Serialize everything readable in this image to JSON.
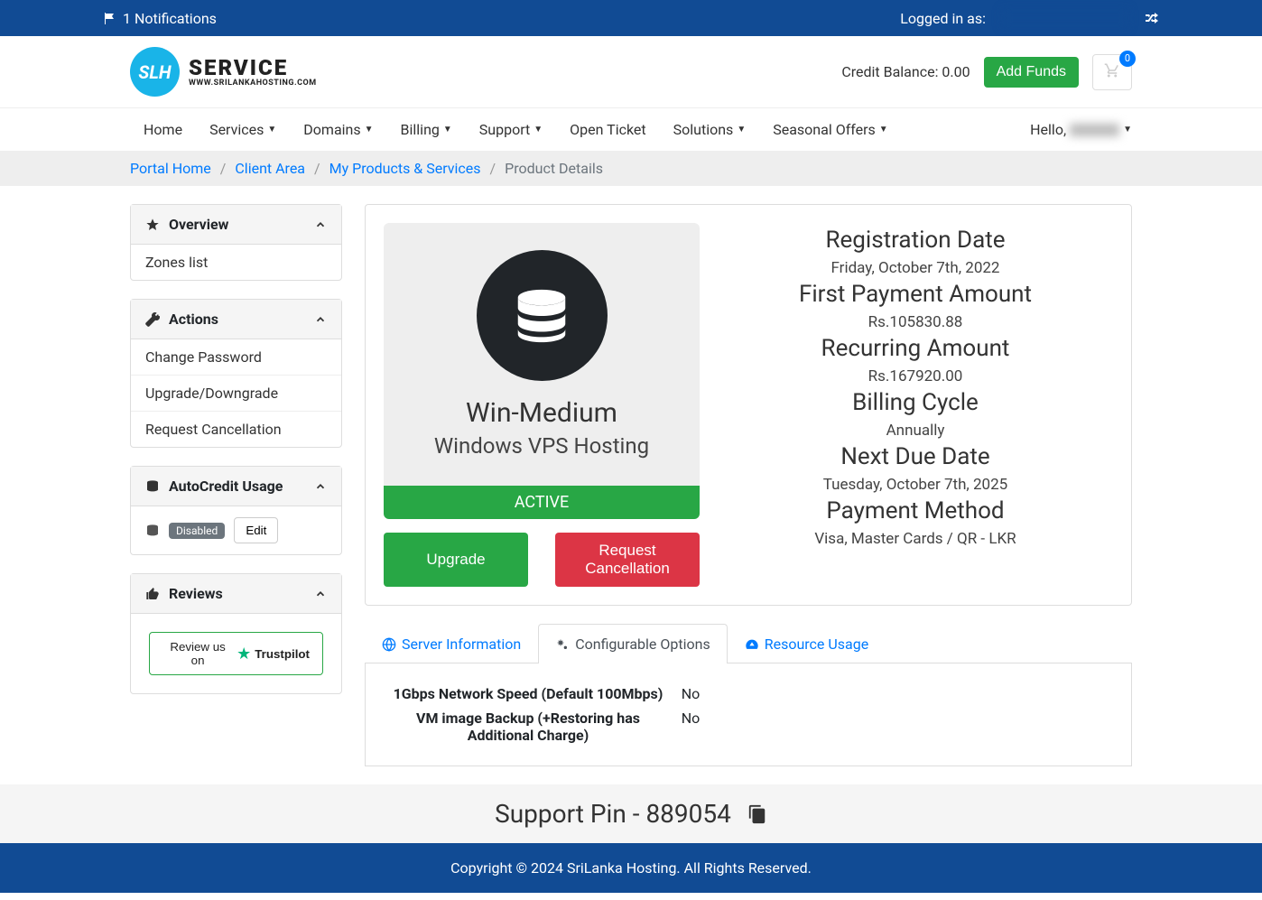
{
  "topbar": {
    "notifications": "1 Notifications",
    "logged_in_as": "Logged in as:"
  },
  "header": {
    "logo_text": "SERVICE",
    "logo_sub": "WWW.SRILANKAHOSTING.COM",
    "logo_badge": "SLH",
    "credit_balance": "Credit Balance: 0.00",
    "add_funds": "Add Funds",
    "cart_count": "0"
  },
  "nav": {
    "items": [
      "Home",
      "Services",
      "Domains",
      "Billing",
      "Support",
      "Open Ticket",
      "Solutions",
      "Seasonal Offers"
    ],
    "hello": "Hello,"
  },
  "breadcrumb": {
    "items": [
      "Portal Home",
      "Client Area",
      "My Products & Services"
    ],
    "current": "Product Details"
  },
  "sidebar": {
    "overview": {
      "title": "Overview",
      "items": [
        "Zones list"
      ]
    },
    "actions": {
      "title": "Actions",
      "items": [
        "Change Password",
        "Upgrade/Downgrade",
        "Request Cancellation"
      ]
    },
    "autocredit": {
      "title": "AutoCredit Usage",
      "badge": "Disabled",
      "edit": "Edit"
    },
    "reviews": {
      "title": "Reviews",
      "review_text": "Review us on",
      "trustpilot": "Trustpilot"
    }
  },
  "product": {
    "name": "Win-Medium",
    "category": "Windows VPS Hosting",
    "status": "ACTIVE",
    "upgrade": "Upgrade",
    "cancel": "Request Cancellation",
    "info": [
      {
        "label": "Registration Date",
        "value": "Friday, October 7th, 2022"
      },
      {
        "label": "First Payment Amount",
        "value": "Rs.105830.88"
      },
      {
        "label": "Recurring Amount",
        "value": "Rs.167920.00"
      },
      {
        "label": "Billing Cycle",
        "value": "Annually"
      },
      {
        "label": "Next Due Date",
        "value": "Tuesday, October 7th, 2025"
      },
      {
        "label": "Payment Method",
        "value": "Visa, Master Cards / QR - LKR"
      }
    ]
  },
  "tabs": {
    "t1": "Server Information",
    "t2": "Configurable Options",
    "t3": "Resource Usage",
    "options": [
      {
        "label": "1Gbps Network Speed (Default 100Mbps)",
        "value": "No"
      },
      {
        "label": "VM image Backup (+Restoring has Additional Charge)",
        "value": "No"
      }
    ]
  },
  "support_pin": "Support Pin - 889054",
  "footer": "Copyright © 2024 SriLanka Hosting. All Rights Reserved."
}
